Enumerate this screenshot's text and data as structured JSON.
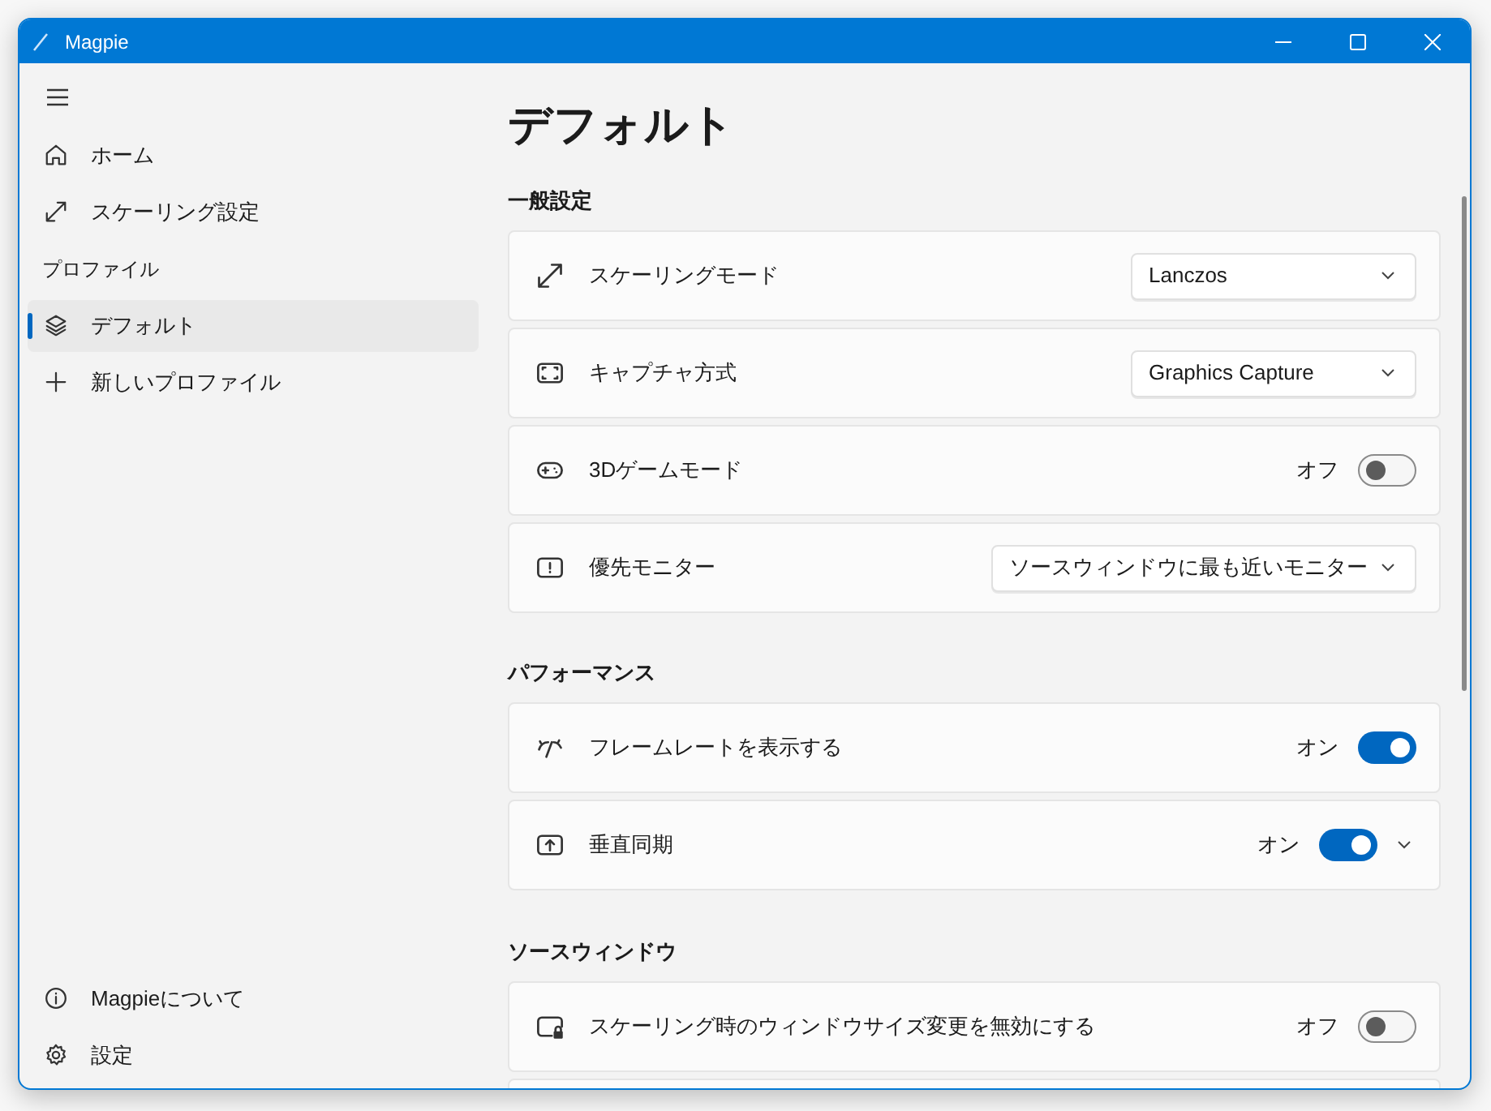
{
  "window": {
    "title": "Magpie"
  },
  "sidebar": {
    "top_items": [
      {
        "label": "ホーム",
        "selected": false
      },
      {
        "label": "スケーリング設定",
        "selected": false
      }
    ],
    "profiles_header": "プロファイル",
    "profiles": [
      {
        "label": "デフォルト",
        "selected": true
      },
      {
        "label": "新しいプロファイル",
        "selected": false
      }
    ],
    "footer_items": [
      {
        "label": "Magpieについて",
        "selected": false
      },
      {
        "label": "設定",
        "selected": false
      }
    ]
  },
  "page": {
    "title": "デフォルト",
    "sections": [
      {
        "title": "一般設定",
        "items": [
          {
            "kind": "dropdown",
            "label": "スケーリングモード",
            "value": "Lanczos"
          },
          {
            "kind": "dropdown",
            "label": "キャプチャ方式",
            "value": "Graphics Capture"
          },
          {
            "kind": "toggle",
            "label": "3Dゲームモード",
            "state_text": "オフ",
            "on": false,
            "expandable": false
          },
          {
            "kind": "dropdown",
            "label": "優先モニター",
            "value": "ソースウィンドウに最も近いモニター"
          }
        ]
      },
      {
        "title": "パフォーマンス",
        "items": [
          {
            "kind": "toggle",
            "label": "フレームレートを表示する",
            "state_text": "オン",
            "on": true,
            "expandable": false
          },
          {
            "kind": "toggle",
            "label": "垂直同期",
            "state_text": "オン",
            "on": true,
            "expandable": true
          }
        ]
      },
      {
        "title": "ソースウィンドウ",
        "items": [
          {
            "kind": "toggle",
            "label": "スケーリング時のウィンドウサイズ変更を無効にする",
            "state_text": "オフ",
            "on": false,
            "expandable": false
          },
          {
            "kind": "blank"
          }
        ]
      }
    ]
  }
}
